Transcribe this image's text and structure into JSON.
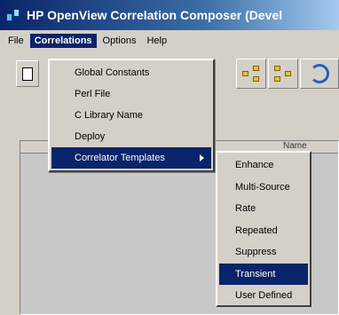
{
  "window": {
    "title": "HP OpenView Correlation Composer (Devel"
  },
  "menubar": {
    "items": [
      {
        "label": "File",
        "active": false
      },
      {
        "label": "Correlations",
        "active": true
      },
      {
        "label": "Options",
        "active": false
      },
      {
        "label": "Help",
        "active": false
      }
    ]
  },
  "correlations_menu": {
    "items": [
      {
        "label": "Global Constants"
      },
      {
        "label": "Perl File"
      },
      {
        "label": "C Library Name"
      },
      {
        "label": "Deploy"
      },
      {
        "label": "Correlator Templates",
        "has_submenu": true,
        "selected": true
      }
    ]
  },
  "templates_submenu": {
    "items": [
      {
        "label": "Enhance"
      },
      {
        "label": "Multi-Source"
      },
      {
        "label": "Rate"
      },
      {
        "label": "Repeated"
      },
      {
        "label": "Suppress"
      },
      {
        "label": "Transient",
        "selected": true
      },
      {
        "label": "User Defined"
      }
    ]
  },
  "table": {
    "column_header": "Name"
  },
  "colors": {
    "titlebar": "#0a246a",
    "menu_highlight": "#0a246a",
    "background": "#d4d0c8"
  }
}
